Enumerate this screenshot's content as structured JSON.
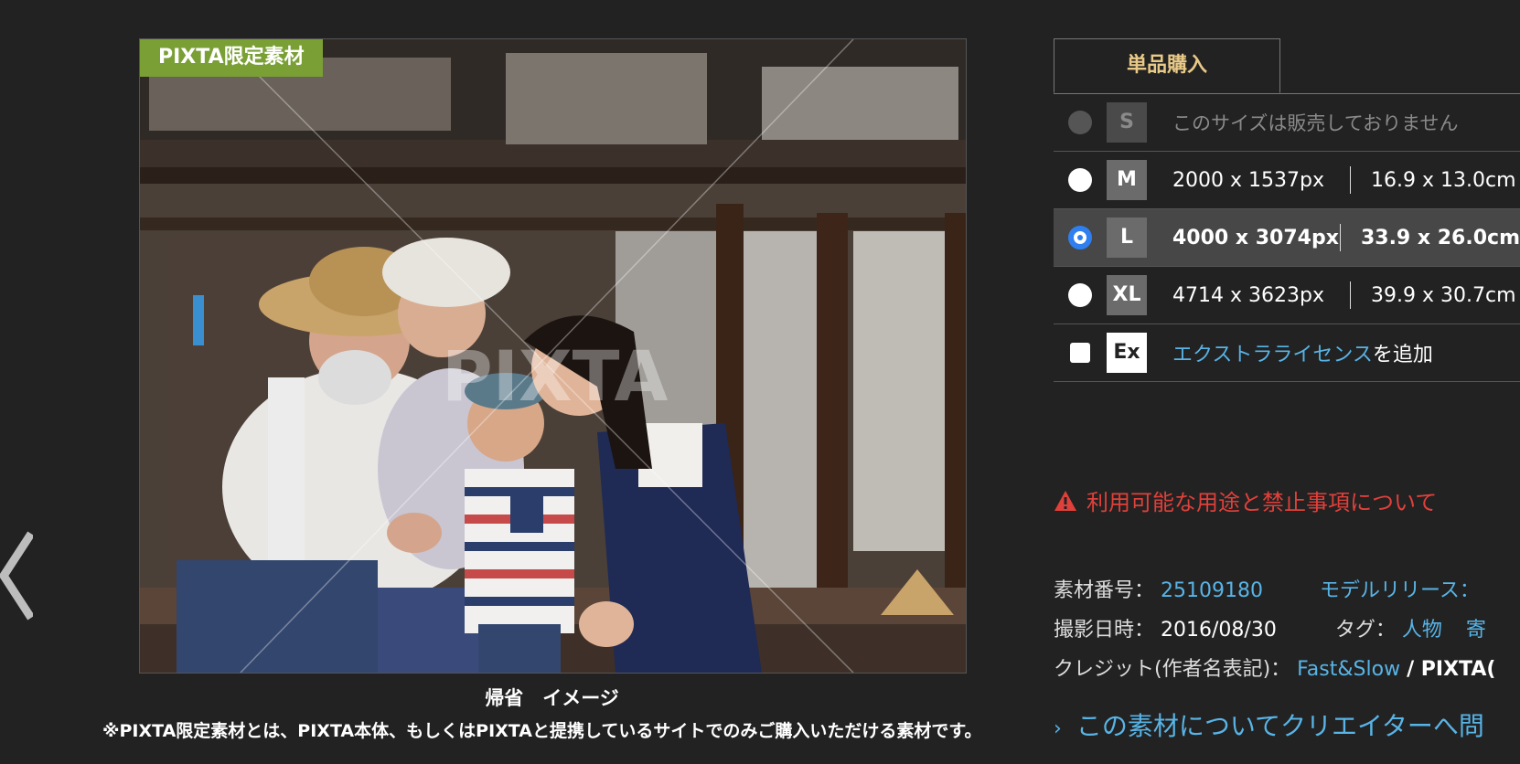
{
  "image": {
    "badge": "PIXTA限定素材",
    "watermark": "PIXTA",
    "caption": "帰省　イメージ",
    "footnote": "※PIXTA限定素材とは、PIXTA本体、もしくはPIXTAと提携しているサイトでのみご購入いただける素材です。"
  },
  "purchase": {
    "tab_label": "単品購入",
    "sizes": [
      {
        "code": "S",
        "unavailable_text": "このサイズは販売しておりません"
      },
      {
        "code": "M",
        "px": "2000 x 1537px",
        "cm": "16.9 x 13.0cm"
      },
      {
        "code": "L",
        "px": "4000 x 3074px",
        "cm": "33.9 x 26.0cm"
      },
      {
        "code": "XL",
        "px": "4714 x 3623px",
        "cm": "39.9 x 30.7cm"
      }
    ],
    "extra": {
      "code": "Ex",
      "link": "エクストラライセンス",
      "suffix": "を追加"
    }
  },
  "usage_link": "利用可能な用途と禁止事項について",
  "meta": {
    "id_label": "素材番号：",
    "id_value": "25109180",
    "model_release_label": "モデルリリース：",
    "date_label": "撮影日時：",
    "date_value": "2016/08/30",
    "tag_label": "タグ：",
    "tags": [
      "人物",
      "寄"
    ],
    "credit_label": "クレジット(作者名表記)：",
    "credit_author": "Fast&Slow",
    "credit_suffix": " / PIXTA("
  },
  "contact_link": "この素材についてクリエイターへ問",
  "colors": {
    "background": "#222222",
    "badge_green": "#7a9f35",
    "tab_gold": "#e8c987",
    "link_blue": "#58b4e6",
    "warning_red": "#e0403a",
    "radio_blue": "#2f7ff0"
  }
}
